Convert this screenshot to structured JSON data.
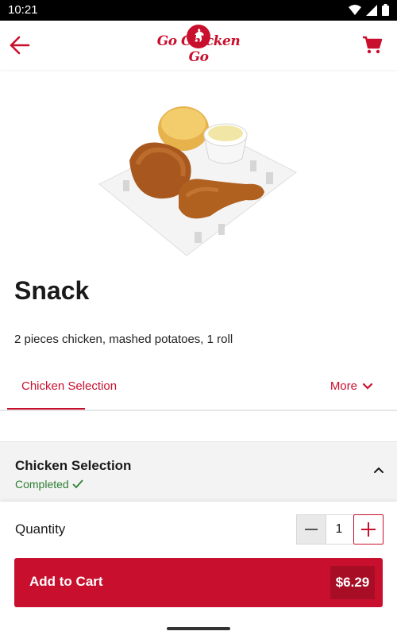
{
  "status_bar": {
    "time": "10:21",
    "icons": [
      "wifi-icon",
      "signal-icon",
      "battery-icon"
    ]
  },
  "app_bar": {
    "brand": "Go Chicken Go",
    "back_icon": "arrow-left-icon",
    "cart_icon": "cart-icon"
  },
  "product": {
    "name": "Snack",
    "description": "2 pieces chicken, mashed potatoes, 1 roll"
  },
  "tabs": [
    {
      "label": "Chicken Selection",
      "active": true
    },
    {
      "label": "More"
    }
  ],
  "section": {
    "title": "Chicken Selection",
    "status": "Completed"
  },
  "quantity": {
    "label": "Quantity",
    "value": "1"
  },
  "add_to_cart": {
    "label": "Add to Cart",
    "price": "$6.29"
  },
  "colors": {
    "brand_red": "#c8102e",
    "dark_red": "#a70e26",
    "success_green": "#2e7d32"
  }
}
